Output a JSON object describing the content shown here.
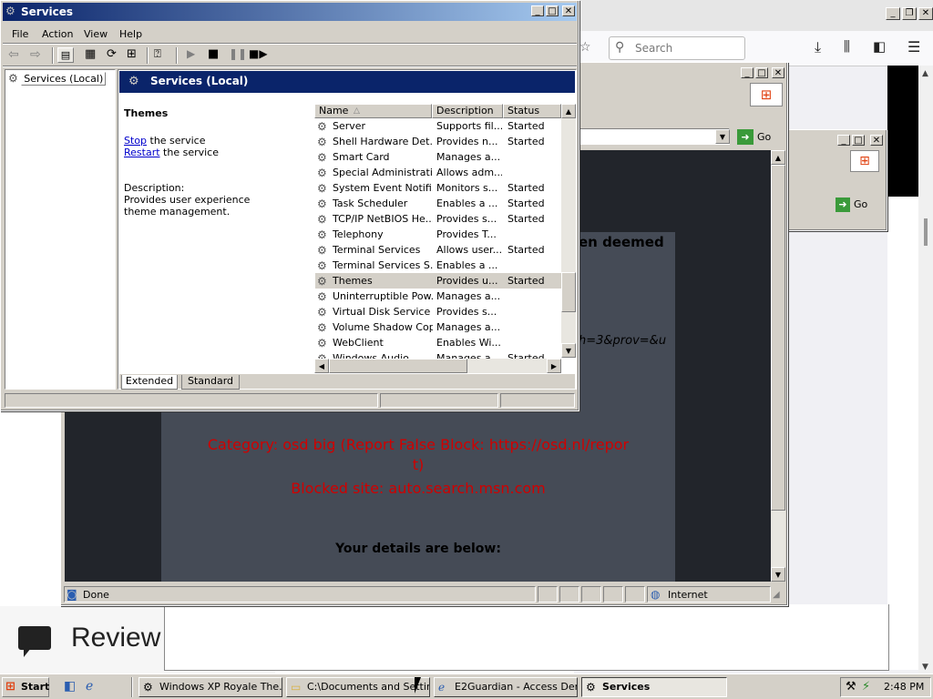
{
  "firefox": {
    "search_placeholder": "Search",
    "review_label": "Review"
  },
  "ie_window": {
    "status_done": "Done",
    "zone": "Internet",
    "go_label": "Go",
    "page": {
      "partial_heading": "en deemed",
      "partial_url": "h=3&prov=&u",
      "category_line1": "Category: osd big (Report False Block: https://osd.nl/repor",
      "category_line2": "t)",
      "blocked_site": "Blocked site: auto.search.msn.com",
      "details": "Your details are below:"
    }
  },
  "ie_window2": {
    "go_label": "Go"
  },
  "services": {
    "title": "Services",
    "menu": [
      "File",
      "Action",
      "View",
      "Help"
    ],
    "tree_item": "Services (Local)",
    "header_title": "Services (Local)",
    "detail": {
      "name": "Themes",
      "stop_link": "Stop",
      "stop_text": " the service",
      "restart_link": "Restart",
      "restart_text": " the service",
      "desc_label": "Description:",
      "desc_text": "Provides user experience theme management."
    },
    "columns": {
      "name": "Name",
      "description": "Description",
      "status": "Status"
    },
    "rows": [
      {
        "name": "Server",
        "description": "Supports fil...",
        "status": "Started"
      },
      {
        "name": "Shell Hardware Det...",
        "description": "Provides n...",
        "status": "Started"
      },
      {
        "name": "Smart Card",
        "description": "Manages a...",
        "status": ""
      },
      {
        "name": "Special Administrati...",
        "description": "Allows adm...",
        "status": ""
      },
      {
        "name": "System Event Notifi...",
        "description": "Monitors s...",
        "status": "Started"
      },
      {
        "name": "Task Scheduler",
        "description": "Enables a ...",
        "status": "Started"
      },
      {
        "name": "TCP/IP NetBIOS He...",
        "description": "Provides s...",
        "status": "Started"
      },
      {
        "name": "Telephony",
        "description": "Provides T...",
        "status": ""
      },
      {
        "name": "Terminal Services",
        "description": "Allows user...",
        "status": "Started"
      },
      {
        "name": "Terminal Services S...",
        "description": "Enables a ...",
        "status": ""
      },
      {
        "name": "Themes",
        "description": "Provides u...",
        "status": "Started"
      },
      {
        "name": "Uninterruptible Pow...",
        "description": "Manages a...",
        "status": ""
      },
      {
        "name": "Virtual Disk Service",
        "description": "Provides s...",
        "status": ""
      },
      {
        "name": "Volume Shadow Copy",
        "description": "Manages a...",
        "status": ""
      },
      {
        "name": "WebClient",
        "description": "Enables Wi...",
        "status": ""
      },
      {
        "name": "Windows Audio",
        "description": "Manages a...",
        "status": "Started"
      }
    ],
    "tabs": [
      "Extended",
      "Standard"
    ]
  },
  "taskbar": {
    "start": "Start",
    "buttons": [
      "Windows XP Royale The...",
      "C:\\Documents and Settin...",
      "E2Guardian - Access Den...",
      "Services"
    ],
    "clock": "2:48 PM"
  },
  "colors": {
    "blocked_text": "#d00000",
    "page_bg": "#454b56",
    "titlebar_active": "#0a246a"
  }
}
